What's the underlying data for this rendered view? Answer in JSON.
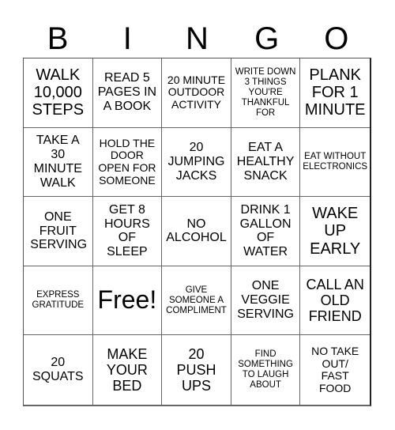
{
  "header": {
    "letters": [
      "B",
      "I",
      "N",
      "G",
      "O"
    ]
  },
  "cells": [
    [
      "WALK 10,000 STEPS",
      "READ 5 PAGES IN A BOOK",
      "20 MINUTE OUTDOOR ACTIVITY",
      "WRITE DOWN 3 THINGS YOU'RE THANKFUL FOR",
      "PLANK FOR 1 MINUTE"
    ],
    [
      "TAKE A 30 MINUTE WALK",
      "HOLD THE DOOR OPEN FOR SOMEONE",
      "20 JUMPING JACKS",
      "EAT A HEALTHY SNACK",
      "EAT WITHOUT ELECTRONICS"
    ],
    [
      "ONE FRUIT SERVING",
      "GET 8 HOURS OF SLEEP",
      "NO ALCOHOL",
      "DRINK 1 GALLON OF WATER",
      "WAKE UP EARLY"
    ],
    [
      "EXPRESS GRATITUDE",
      "Free!",
      "GIVE SOMEONE A COMPLIMENT",
      "ONE VEGGIE SERVING",
      "CALL AN OLD FRIEND"
    ],
    [
      "20 SQUATS",
      "MAKE YOUR BED",
      "20 PUSH UPS",
      "FIND SOMETHING TO LAUGH ABOUT",
      "NO TAKE OUT/ FAST FOOD"
    ]
  ]
}
